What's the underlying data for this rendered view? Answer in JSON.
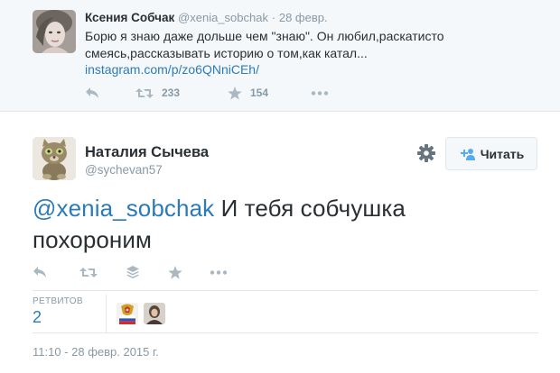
{
  "parent_tweet": {
    "author_name": "Ксения Собчак",
    "author_handle": "@xenia_sobchak",
    "separator": "·",
    "date": "28 февр.",
    "text_line1": "Борю я знаю даже дольше чем \"знаю\". Он любил,раскатисто",
    "text_line2": "смеясь,рассказывать историю о том,как катал...",
    "link": "instagram.com/p/zo6QNniCEh/",
    "retweets": "233",
    "favorites": "154"
  },
  "main_tweet": {
    "author_name": "Наталия Сычева",
    "author_handle": "@sychevan57",
    "follow_label": "Читать",
    "mention": "@xenia_sobchak",
    "text_line1_rest": " И тебя собчушка",
    "text_line2": "похороним",
    "retweets_label": "РЕТВИТОВ",
    "retweets_count": "2",
    "timestamp": "11:10 - 28 февр. 2015 г."
  },
  "icons": {
    "reply": "reply-icon",
    "retweet": "retweet-icon",
    "favorite": "star-icon",
    "more": "more-icon",
    "collection": "stack-icon",
    "settings": "gear-icon",
    "follow": "add-user-icon"
  },
  "colors": {
    "link": "#2b7bb9",
    "text": "#292f33",
    "muted": "#8899a6",
    "icon": "#aab8c2",
    "border": "#e1e8ed",
    "parent_bg": "#f5f8fa"
  }
}
